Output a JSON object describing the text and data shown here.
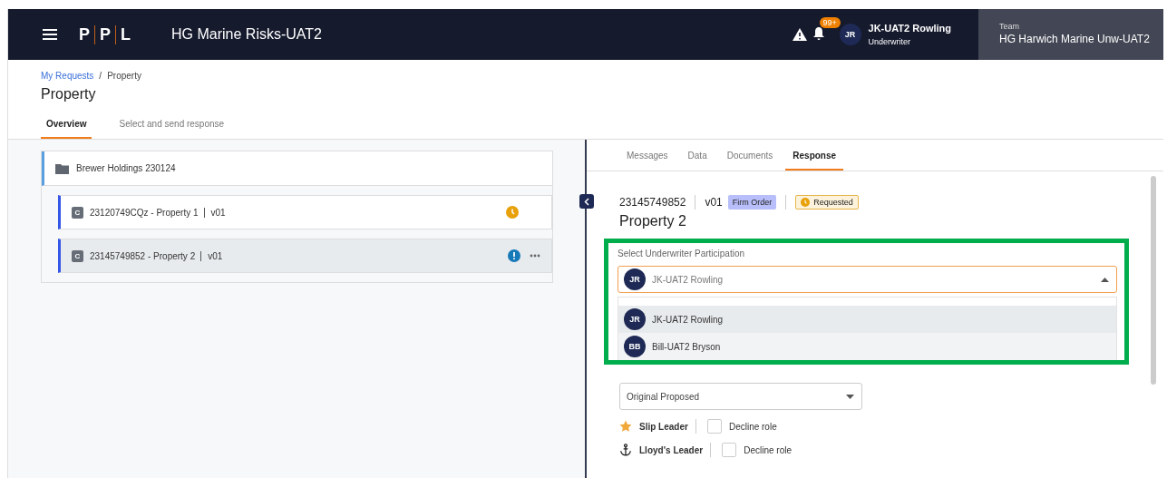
{
  "header": {
    "logo": [
      "P",
      "P",
      "L"
    ],
    "app_title": "HG Marine Risks-UAT2",
    "notification_count": "99+",
    "user": {
      "initials": "JR",
      "name": "JK-UAT2 Rowling",
      "role": "Underwriter"
    },
    "team": {
      "label": "Team",
      "name": "HG Harwich Marine Unw-UAT2"
    }
  },
  "breadcrumb": [
    {
      "label": "My Requests",
      "kind": "link"
    },
    {
      "label": "/",
      "kind": "separator"
    },
    {
      "label": "Property",
      "kind": "current"
    }
  ],
  "page_title": "Property",
  "page_tabs": [
    {
      "label": "Overview",
      "selected": true
    },
    {
      "label": "Select and send response",
      "selected": false
    }
  ],
  "tree": {
    "folder": "Brewer Holdings 230124",
    "items": [
      {
        "badge": "C",
        "title": "23120749CQz - Property 1",
        "version": "v01",
        "kind": "pending",
        "selected": false,
        "menu": false
      },
      {
        "badge": "C",
        "title": "23145749852 - Property 2",
        "version": "v01",
        "kind": "alert",
        "selected": true,
        "menu": true
      }
    ]
  },
  "detail_tabs": [
    {
      "label": "Messages",
      "selected": false
    },
    {
      "label": "Data",
      "selected": false
    },
    {
      "label": "Documents",
      "selected": false
    },
    {
      "label": "Response",
      "selected": true
    }
  ],
  "detail": {
    "reference": "23145749852",
    "version": "v01",
    "order_tag": "Firm Order",
    "status": "Requested",
    "title": "Property 2",
    "participation": {
      "label": "Select Underwriter Participation",
      "value": {
        "initials": "JR",
        "name": "JK-UAT2 Rowling"
      },
      "expanded": true,
      "options": [
        {
          "initials": "JR",
          "name": "JK-UAT2 Rowling",
          "selected": true
        },
        {
          "initials": "BB",
          "name": "Bill-UAT2 Bryson",
          "selected": false
        }
      ]
    },
    "proposal": "Original Proposed",
    "roles": [
      {
        "kind": "star",
        "label": "Slip Leader",
        "checkbox": "Decline role",
        "checked": false
      },
      {
        "kind": "anchor",
        "label": "Lloyd's Leader",
        "checkbox": "Decline role",
        "checked": false
      }
    ]
  }
}
